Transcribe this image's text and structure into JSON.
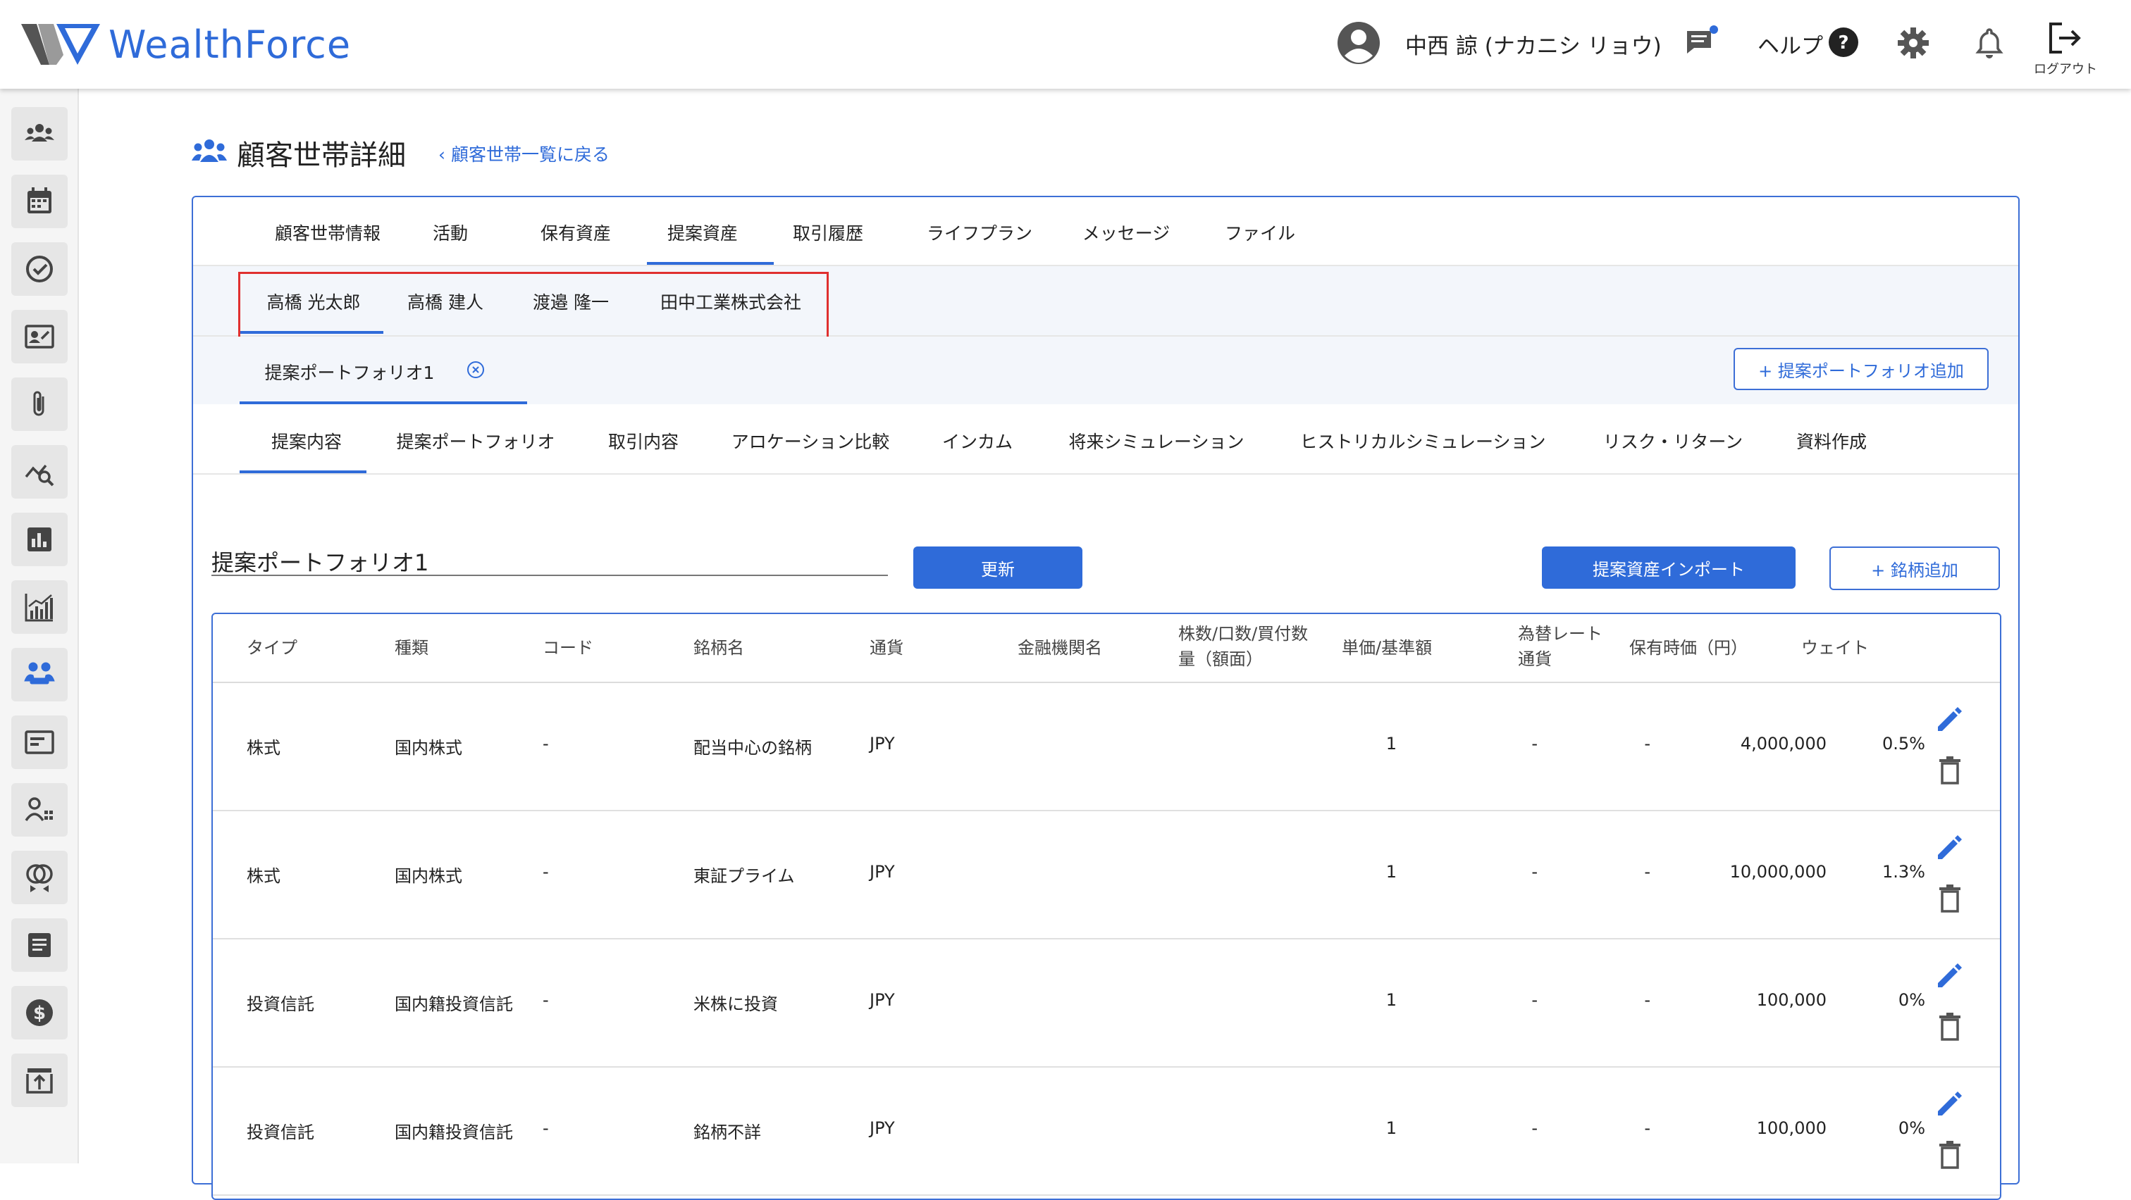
{
  "app": {
    "logo_text": "WealthForce"
  },
  "header": {
    "user_name": "中西 諒 (ナカニシ リョウ)",
    "help_label": "ヘルプ",
    "logout_label": "ログアウト"
  },
  "sidebar": {
    "items": [
      {
        "icon": "people-group-icon"
      },
      {
        "icon": "calendar-icon"
      },
      {
        "icon": "check-circle-icon"
      },
      {
        "icon": "contact-card-icon"
      },
      {
        "icon": "paperclip-icon"
      },
      {
        "icon": "chart-search-icon"
      },
      {
        "icon": "bar-report-icon"
      },
      {
        "icon": "growth-chart-icon"
      },
      {
        "icon": "household-icon",
        "active": true
      },
      {
        "icon": "web-page-icon"
      },
      {
        "icon": "user-list-icon"
      },
      {
        "icon": "rings-icon"
      },
      {
        "icon": "document-icon"
      },
      {
        "icon": "dollar-icon"
      },
      {
        "icon": "upload-icon"
      }
    ]
  },
  "page": {
    "title": "顧客世帯詳細",
    "back_link": "顧客世帯一覧に戻る"
  },
  "main_tabs": [
    "顧客世帯情報",
    "活動",
    "保有資産",
    "提案資産",
    "取引履歴",
    "ライフプラン",
    "メッセージ",
    "ファイル"
  ],
  "main_tabs_active": "提案資産",
  "member_tabs": [
    "高橋 光太郎",
    "高橋 建人",
    "渡邉 隆一",
    "田中工業株式会社"
  ],
  "member_tabs_active": "高橋 光太郎",
  "portfolio_tabs": [
    "提案ポートフォリオ1"
  ],
  "add_portfolio_button": "+ 提案ポートフォリオ追加",
  "sub_tabs": [
    "提案内容",
    "提案ポートフォリオ",
    "取引内容",
    "アロケーション比較",
    "インカム",
    "将来シミュレーション",
    "ヒストリカルシミュレーション",
    "リスク・リターン",
    "資料作成"
  ],
  "sub_tabs_active": "提案内容",
  "portfolio_name_value": "提案ポートフォリオ1",
  "update_button": "更新",
  "import_button": "提案資産インポート",
  "add_stock_button": "+ 銘柄追加",
  "table": {
    "headers": [
      "タイプ",
      "種類",
      "コード",
      "銘柄名",
      "通貨",
      "金融機関名",
      "株数/口数/買付数量（額面）",
      "単価/基準額",
      "為替レート 通貨",
      "保有時価（円）",
      "ウェイト"
    ],
    "rows": [
      {
        "type": "株式",
        "kind": "国内株式",
        "code": "-",
        "name": "配当中心の銘柄",
        "currency": "JPY",
        "institution": "",
        "qty": "1",
        "unit_price": "-",
        "fx": "-",
        "value": "4,000,000",
        "weight": "0.5%"
      },
      {
        "type": "株式",
        "kind": "国内株式",
        "code": "-",
        "name": "東証プライム",
        "currency": "JPY",
        "institution": "",
        "qty": "1",
        "unit_price": "-",
        "fx": "-",
        "value": "10,000,000",
        "weight": "1.3%"
      },
      {
        "type": "投資信託",
        "kind": "国内籍投資信託",
        "code": "-",
        "name": "米株に投資",
        "currency": "JPY",
        "institution": "",
        "qty": "1",
        "unit_price": "-",
        "fx": "-",
        "value": "100,000",
        "weight": "0%"
      },
      {
        "type": "投資信託",
        "kind": "国内籍投資信託",
        "code": "-",
        "name": "銘柄不詳",
        "currency": "JPY",
        "institution": "",
        "qty": "1",
        "unit_price": "-",
        "fx": "-",
        "value": "100,000",
        "weight": "0%"
      }
    ]
  },
  "colors": {
    "accent": "#2f6bd9",
    "highlight": "#e0302f"
  }
}
